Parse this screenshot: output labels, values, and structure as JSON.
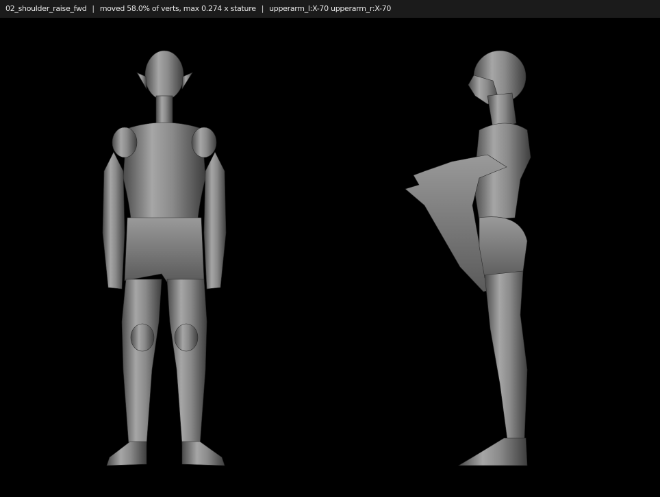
{
  "header": {
    "pose_name": "02_shoulder_raise_fwd",
    "separator": "|",
    "moved_stats": "moved 58.0% of verts, max 0.274 x stature",
    "bone_rotations": "upperarm_l:X-70 upperarm_r:X-70"
  },
  "views": {
    "front": {
      "description": "front view figure"
    },
    "side": {
      "description": "side view figure"
    }
  },
  "colors": {
    "background": "#000000",
    "header_bg": "#1b1b1b",
    "header_text": "#e6e6e6",
    "mesh_base": "#8c8c8c"
  }
}
